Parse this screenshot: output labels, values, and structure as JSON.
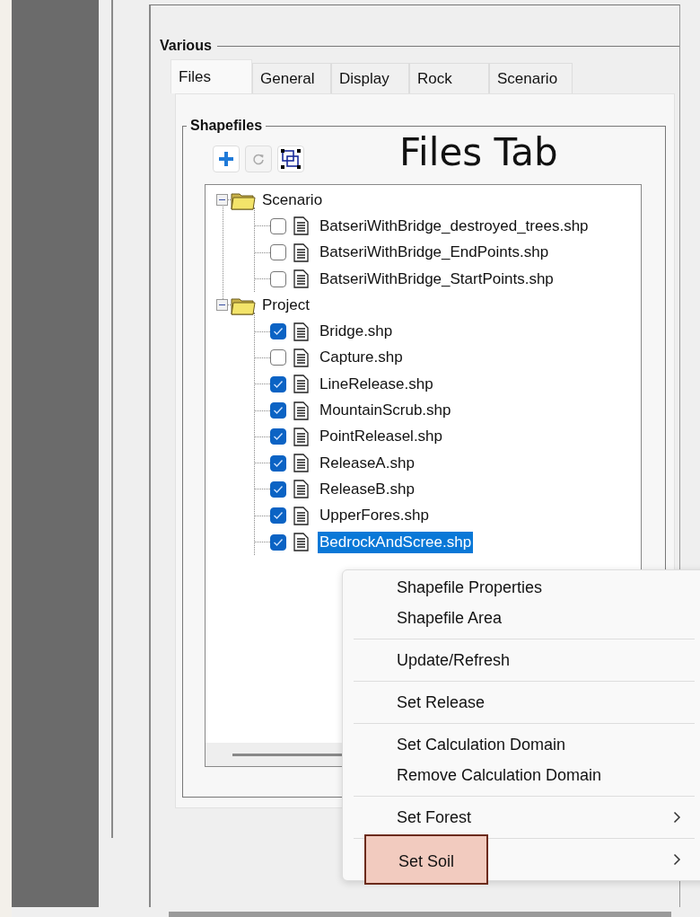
{
  "group_title": "Various",
  "tabs": [
    {
      "label": "Files",
      "selected": true
    },
    {
      "label": "General",
      "selected": false
    },
    {
      "label": "Display",
      "selected": false
    },
    {
      "label": "Rock",
      "selected": false
    },
    {
      "label": "Scenario",
      "selected": false
    }
  ],
  "shapefiles": {
    "title": "Shapefiles",
    "annotation": "Files Tab",
    "tree": [
      {
        "label": "Scenario",
        "expanded": true,
        "children": [
          {
            "label": "BatseriWithBridge_destroyed_trees.shp",
            "checked": false,
            "selected": false
          },
          {
            "label": "BatseriWithBridge_EndPoints.shp",
            "checked": false,
            "selected": false
          },
          {
            "label": "BatseriWithBridge_StartPoints.shp",
            "checked": false,
            "selected": false
          }
        ]
      },
      {
        "label": "Project",
        "expanded": true,
        "children": [
          {
            "label": "Bridge.shp",
            "checked": true,
            "selected": false
          },
          {
            "label": "Capture.shp",
            "checked": false,
            "selected": false
          },
          {
            "label": "LineRelease.shp",
            "checked": true,
            "selected": false
          },
          {
            "label": "MountainScrub.shp",
            "checked": true,
            "selected": false
          },
          {
            "label": "PointReleasel.shp",
            "checked": true,
            "selected": false
          },
          {
            "label": "ReleaseA.shp",
            "checked": true,
            "selected": false
          },
          {
            "label": "ReleaseB.shp",
            "checked": true,
            "selected": false
          },
          {
            "label": "UpperFores.shp",
            "checked": true,
            "selected": false
          },
          {
            "label": "BedrockAndScree.shp",
            "checked": true,
            "selected": true
          }
        ]
      }
    ]
  },
  "context_menu": {
    "groups": [
      [
        {
          "label": "Shapefile Properties",
          "submenu": false,
          "highlighted": false
        },
        {
          "label": "Shapefile Area",
          "submenu": false,
          "highlighted": false
        }
      ],
      [
        {
          "label": "Update/Refresh",
          "submenu": false,
          "highlighted": false
        }
      ],
      [
        {
          "label": "Set Release",
          "submenu": false,
          "highlighted": false
        }
      ],
      [
        {
          "label": "Set Calculation Domain",
          "submenu": false,
          "highlighted": false
        },
        {
          "label": "Remove Calculation Domain",
          "submenu": false,
          "highlighted": false
        }
      ],
      [
        {
          "label": "Set Forest",
          "submenu": true,
          "highlighted": false
        }
      ],
      [
        {
          "label": "Set Soil",
          "submenu": true,
          "highlighted": true
        }
      ]
    ]
  }
}
